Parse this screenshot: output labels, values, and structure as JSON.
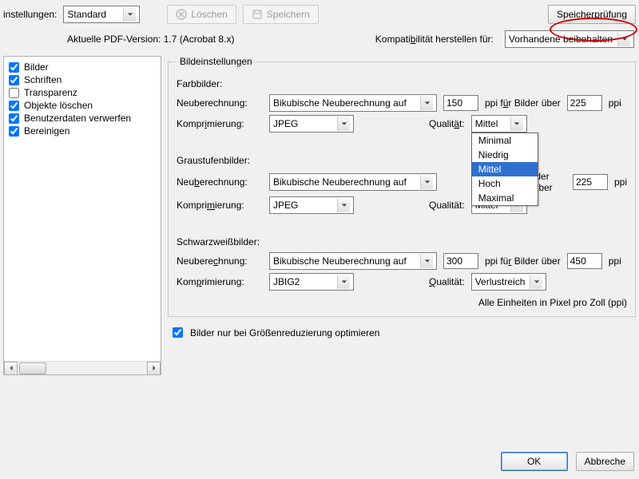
{
  "toolbar": {
    "settings_label": "instellungen:",
    "settings_value": "Standard",
    "delete_label": "Löschen",
    "save_label": "Speichern",
    "check_label": "Speicherprüfung"
  },
  "subheader": {
    "version_label": "Aktuelle PDF-Version:",
    "version_value": "1.7 (Acrobat 8.x)",
    "compat_label": "Kompatibilität herstellen für:",
    "compat_label_u": "b",
    "compat_value": "Vorhandene beibehalten"
  },
  "sidebar": {
    "items": [
      {
        "label": "Bilder",
        "checked": true
      },
      {
        "label": "Schriften",
        "checked": true
      },
      {
        "label": "Transparenz",
        "checked": false
      },
      {
        "label": "Objekte löschen",
        "checked": true
      },
      {
        "label": "Benutzerdaten verwerfen",
        "checked": true
      },
      {
        "label": "Bereinigen",
        "checked": true
      }
    ]
  },
  "panel": {
    "title": "Bildeinstellungen",
    "color": {
      "title": "Farbbilder:",
      "recalc_label": "Neuberechnung:",
      "recalc_value": "Bikubische Neuberechnung auf",
      "recalc_ppi": "150",
      "over_label": "ppi für Bilder über",
      "over_u": "ü",
      "over_ppi": "225",
      "ppi": "ppi",
      "compress_label": "Komprimierung:",
      "compress_u": "i",
      "compress_value": "JPEG",
      "quality_label": "Qualität:",
      "quality_u": "ä",
      "quality_value": "Mittel"
    },
    "gray": {
      "title": "Graustufenbilder:",
      "recalc_label": "Neuberechnung:",
      "recalc_u": "b",
      "recalc_value": "Bikubische Neuberechnung auf",
      "over_label": "lder über",
      "over_ppi": "225",
      "ppi": "ppi",
      "compress_label": "Komprimierung:",
      "compress_u": "m",
      "compress_value": "JPEG",
      "quality_label": "Qualität:",
      "quality_value": "Mittel"
    },
    "mono": {
      "title": "Schwarzweißbilder:",
      "recalc_label": "Neuberechnung:",
      "recalc_u": "c",
      "recalc_value": "Bikubische Neuberechnung auf",
      "recalc_ppi": "300",
      "over_label": "ppi für Bilder über",
      "over_u": "r",
      "over_ppi": "450",
      "ppi": "ppi",
      "compress_label": "Komprimierung:",
      "compress_u": "p",
      "compress_value": "JBIG2",
      "quality_label": "Qualität:",
      "quality_u": "Q",
      "quality_value": "Verlustreich"
    },
    "units": "Alle Einheiten in Pixel pro Zoll (ppi)",
    "optimize_down": "Bilder nur bei Größenreduzierung optimieren",
    "optimize_down_checked": true
  },
  "dropdown": {
    "options": [
      "Minimal",
      "Niedrig",
      "Mittel",
      "Hoch",
      "Maximal"
    ],
    "selected": "Mittel"
  },
  "footer": {
    "ok": "OK",
    "cancel": "Abbreche"
  }
}
